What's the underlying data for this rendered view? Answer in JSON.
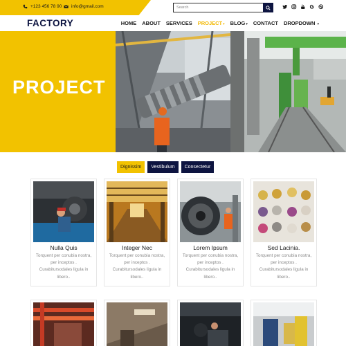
{
  "topbar": {
    "phone": "+123 456 78 90",
    "email": "info@gmail.com",
    "search_placeholder": "Search",
    "social_icons": [
      "twitter-icon",
      "instagram-icon",
      "youtube-icon",
      "google-icon",
      "dribbble-icon"
    ]
  },
  "nav": {
    "logo": "FACTORY",
    "items": [
      {
        "label": "HOME",
        "dropdown": false,
        "active": false
      },
      {
        "label": "ABOUT",
        "dropdown": false,
        "active": false
      },
      {
        "label": "SERVICES",
        "dropdown": false,
        "active": false
      },
      {
        "label": "PROJECT",
        "dropdown": true,
        "active": true
      },
      {
        "label": "BLOG",
        "dropdown": true,
        "active": false
      },
      {
        "label": "CONTACT",
        "dropdown": false,
        "active": false
      },
      {
        "label": "DROPDOWN",
        "dropdown": true,
        "active": false
      }
    ]
  },
  "hero": {
    "title": "PROJECT"
  },
  "filters": [
    {
      "label": "Dignissim",
      "active": true
    },
    {
      "label": "Vestibulum",
      "active": false
    },
    {
      "label": "Consectetur",
      "active": false
    }
  ],
  "cards": [
    {
      "title": "Nulla Quis",
      "description": "Torquent per conubia nostra, per inceptos . Curabitursodales ligula in libero.."
    },
    {
      "title": "Integer Nec",
      "description": "Torquent per conubia nostra, per inceptos . Curabitursodales ligula in libero.."
    },
    {
      "title": "Lorem Ipsum",
      "description": "Torquent per conubia nostra, per inceptos . Curabitursodales ligula in libero.."
    },
    {
      "title": "Sed Lacinia.",
      "description": "Torquent per conubia nostra, per inceptos . Curabitursodales ligula in libero.."
    }
  ],
  "colors": {
    "accent": "#f2c200",
    "navy": "#0d1440",
    "text": "#1a1a1a",
    "muted": "#8a8a8a"
  }
}
